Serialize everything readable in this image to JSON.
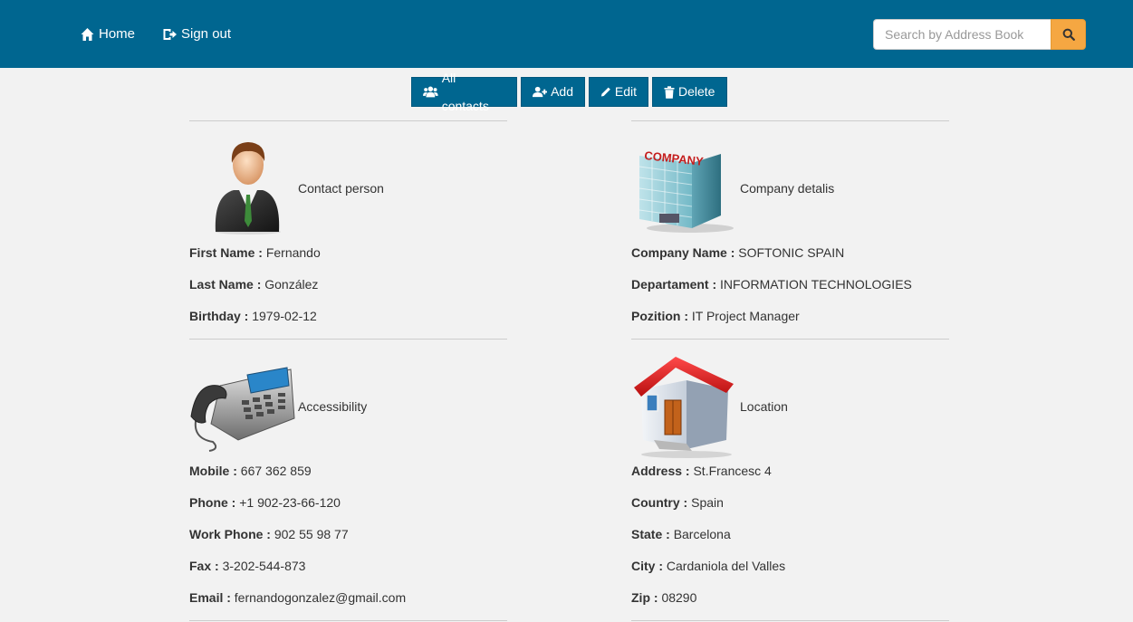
{
  "nav": {
    "home_label": "Home",
    "signout_label": "Sign out",
    "search_placeholder": "Search by Address Book"
  },
  "toolbar": {
    "all_contacts": "All contacts",
    "add": "Add",
    "edit": "Edit",
    "delete": "Delete"
  },
  "contact": {
    "title": "Contact person",
    "first_name_label": "First Name :",
    "first_name": "Fernando",
    "last_name_label": "Last Name :",
    "last_name": "González",
    "birthday_label": "Birthday :",
    "birthday": "1979-02-12"
  },
  "company": {
    "title": "Company detalis",
    "logo_text": "COMPANY",
    "name_label": "Company Name :",
    "name": "SOFTONIC SPAIN",
    "department_label": "Departament :",
    "department": "INFORMATION TECHNOLOGIES",
    "position_label": "Pozition :",
    "position": "IT Project Manager"
  },
  "accessibility": {
    "title": "Accessibility",
    "mobile_label": "Mobile :",
    "mobile": "667 362 859",
    "phone_label": "Phone :",
    "phone": "+1 902-23-66-120",
    "work_phone_label": "Work Phone :",
    "work_phone": "902 55 98 77",
    "fax_label": "Fax :",
    "fax": "3-202-544-873",
    "email_label": "Email :",
    "email": "fernandogonzalez@gmail.com"
  },
  "location": {
    "title": "Location",
    "address_label": "Address :",
    "address": "St.Francesc 4",
    "country_label": "Country :",
    "country": "Spain",
    "state_label": "State :",
    "state": "Barcelona",
    "city_label": "City :",
    "city": "Cardaniola del Valles",
    "zip_label": "Zip :",
    "zip": "08290"
  },
  "colors": {
    "navbar": "#006690",
    "search_button": "#f5a742",
    "background": "#f2f2f2"
  }
}
